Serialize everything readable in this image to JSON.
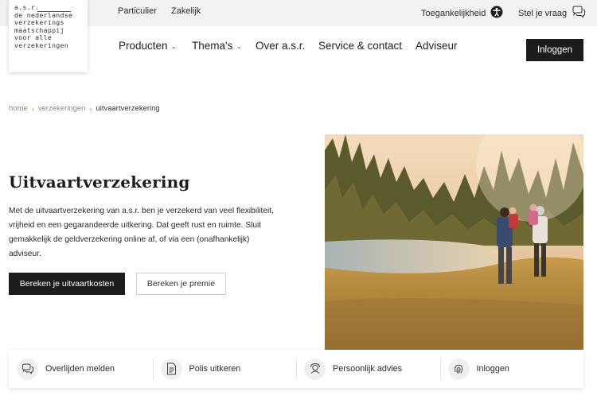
{
  "logo": {
    "lines": [
      "a.s.r.",
      "de nederlandse",
      "verzekerings",
      "maatschappij",
      "voor alle",
      "verzekeringen"
    ]
  },
  "topbar": {
    "segments": [
      "Particulier",
      "Zakelijk"
    ],
    "accessibility_label": "Toegankelijkheid",
    "ask_label": "Stel je vraag"
  },
  "nav": {
    "items": [
      {
        "label": "Producten",
        "has_dropdown": true
      },
      {
        "label": "Thema's",
        "has_dropdown": true
      },
      {
        "label": "Over a.s.r.",
        "has_dropdown": false
      },
      {
        "label": "Service & contact",
        "has_dropdown": false
      },
      {
        "label": "Adviseur",
        "has_dropdown": false
      }
    ],
    "login_label": "Inloggen"
  },
  "breadcrumb": [
    "home",
    "verzekeringen",
    "uitvaartverzekering"
  ],
  "hero": {
    "title": "Uitvaartverzekering",
    "text": "Met de uitvaartverzekering van a.s.r. ben je verzekerd van veel flexibiliteit, vrijheid en een gegarandeerde uitkering. Dat geeft rust en ruimte. Sluit gemakkelijk de geldverzekering online af, of via een (onafhankelijk) adviseur.",
    "primary_button": "Bereken je uitvaartkosten",
    "secondary_button": "Bereken je premie"
  },
  "quick_actions": [
    {
      "label": "Overlijden melden",
      "icon": "chat-bubbles-icon"
    },
    {
      "label": "Polis uitkeren",
      "icon": "document-icon"
    },
    {
      "label": "Persoonlijk advies",
      "icon": "advisor-icon"
    },
    {
      "label": "Inloggen",
      "icon": "fingerprint-icon"
    }
  ],
  "colors": {
    "accent": "#e07b1a",
    "dark_button": "#1c1c1c",
    "topbar_bg": "#f2f2f2"
  }
}
